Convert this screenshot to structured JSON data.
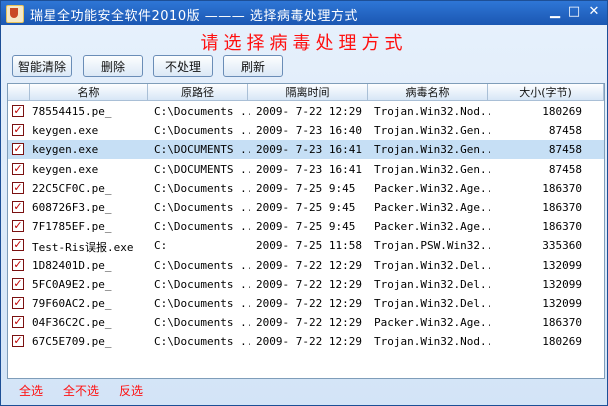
{
  "window": {
    "title": "瑞星全功能安全软件2010版 ——— 选择病毒处理方式"
  },
  "headline": "请选择病毒处理方式",
  "toolbar": {
    "smart_clear": "智能清除",
    "delete": "删除",
    "no_action": "不处理",
    "refresh": "刷新"
  },
  "columns": [
    "名称",
    "原路径",
    "隔离时间",
    "病毒名称",
    "大小(字节)"
  ],
  "rows": [
    {
      "name": "78554415.pe_",
      "path": "C:\\Documents ...",
      "time": "2009- 7-22 12:29",
      "virus": "Trojan.Win32.Nod...",
      "size": "180269",
      "checked": true,
      "selected": false
    },
    {
      "name": "keygen.exe",
      "path": "C:\\Documents ...",
      "time": "2009- 7-23 16:40",
      "virus": "Trojan.Win32.Gen...",
      "size": "87458",
      "checked": true,
      "selected": false
    },
    {
      "name": "keygen.exe",
      "path": "C:\\DOCUMENTS ...",
      "time": "2009- 7-23 16:41",
      "virus": "Trojan.Win32.Gen...",
      "size": "87458",
      "checked": true,
      "selected": true
    },
    {
      "name": "keygen.exe",
      "path": "C:\\DOCUMENTS ...",
      "time": "2009- 7-23 16:41",
      "virus": "Trojan.Win32.Gen...",
      "size": "87458",
      "checked": true,
      "selected": false
    },
    {
      "name": "22C5CF0C.pe_",
      "path": "C:\\Documents ...",
      "time": "2009- 7-25  9:45",
      "virus": "Packer.Win32.Age...",
      "size": "186370",
      "checked": true,
      "selected": false
    },
    {
      "name": "608726F3.pe_",
      "path": "C:\\Documents ...",
      "time": "2009- 7-25  9:45",
      "virus": "Packer.Win32.Age...",
      "size": "186370",
      "checked": true,
      "selected": false
    },
    {
      "name": "7F1785EF.pe_",
      "path": "C:\\Documents ...",
      "time": "2009- 7-25  9:45",
      "virus": "Packer.Win32.Age...",
      "size": "186370",
      "checked": true,
      "selected": false
    },
    {
      "name": "Test-Ris误报.exe",
      "path": "C:",
      "time": "2009- 7-25 11:58",
      "virus": "Trojan.PSW.Win32...",
      "size": "335360",
      "checked": true,
      "selected": false
    },
    {
      "name": "1D82401D.pe_",
      "path": "C:\\Documents ...",
      "time": "2009- 7-22 12:29",
      "virus": "Trojan.Win32.Del...",
      "size": "132099",
      "checked": true,
      "selected": false
    },
    {
      "name": "5FC0A9E2.pe_",
      "path": "C:\\Documents ...",
      "time": "2009- 7-22 12:29",
      "virus": "Trojan.Win32.Del...",
      "size": "132099",
      "checked": true,
      "selected": false
    },
    {
      "name": "79F60AC2.pe_",
      "path": "C:\\Documents ...",
      "time": "2009- 7-22 12:29",
      "virus": "Trojan.Win32.Del...",
      "size": "132099",
      "checked": true,
      "selected": false
    },
    {
      "name": "04F36C2C.pe_",
      "path": "C:\\Documents ...",
      "time": "2009- 7-22 12:29",
      "virus": "Packer.Win32.Age...",
      "size": "186370",
      "checked": true,
      "selected": false
    },
    {
      "name": "67C5E709.pe_",
      "path": "C:\\Documents ...",
      "time": "2009- 7-22 12:29",
      "virus": "Trojan.Win32.Nod...",
      "size": "180269",
      "checked": true,
      "selected": false
    }
  ],
  "footer": {
    "select_all": "全选",
    "select_none": "全不选",
    "invert": "反选"
  },
  "colors": {
    "accent": "#1b57b2",
    "alert": "#ff1010",
    "selection": "#c6dff5"
  }
}
